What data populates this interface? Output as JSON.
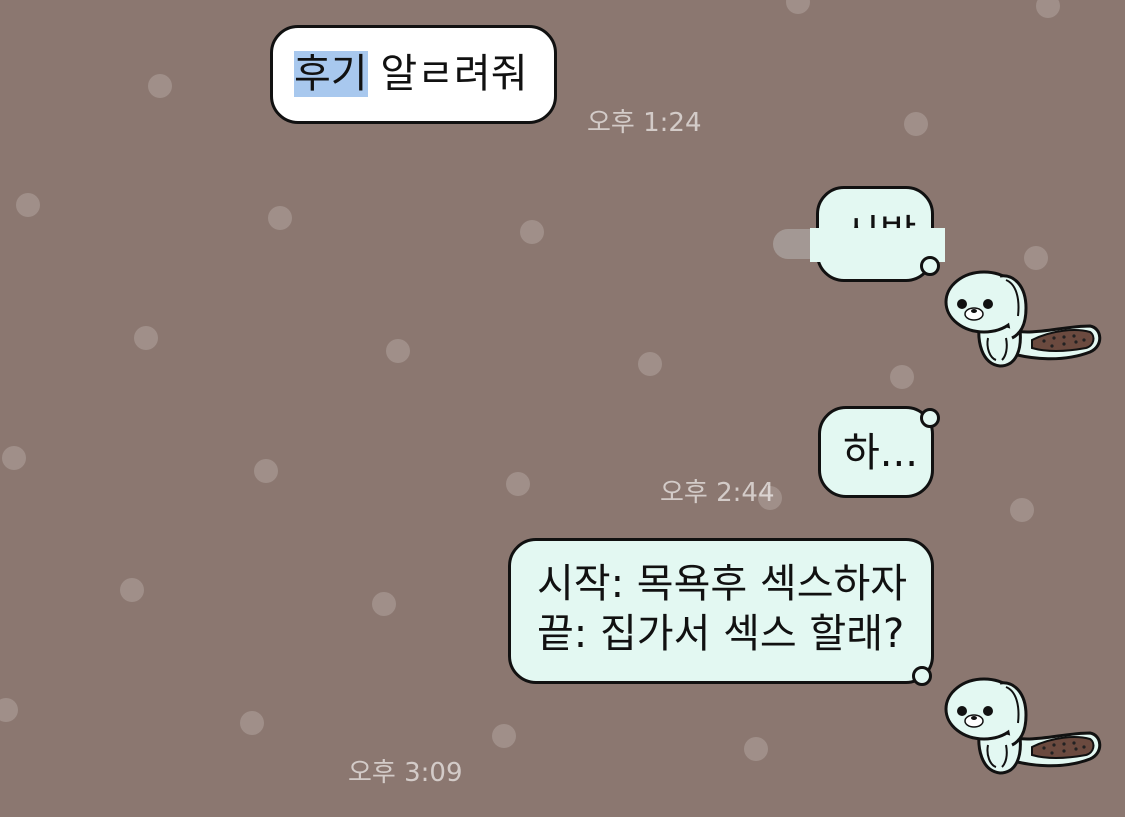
{
  "messages": {
    "m1": {
      "highlighted": "후기",
      "rest": " 알ㄹ려줘",
      "time": "오후 1:24"
    },
    "m2": {
      "text": "시발"
    },
    "m3": {
      "text": "하...",
      "time": "오후 2:44"
    },
    "m4": {
      "line1": "시작: 목욕후 섹스하자",
      "line2": "끝: 집가서 섹스 할래?",
      "time": "오후 3:09"
    }
  },
  "icons": {
    "sticker": "seal-character-sticker"
  },
  "colors": {
    "background": "#8b7770",
    "incoming_bubble": "#ffffff",
    "outgoing_bubble": "#e3f8f2",
    "highlight": "#a8c8ee"
  }
}
